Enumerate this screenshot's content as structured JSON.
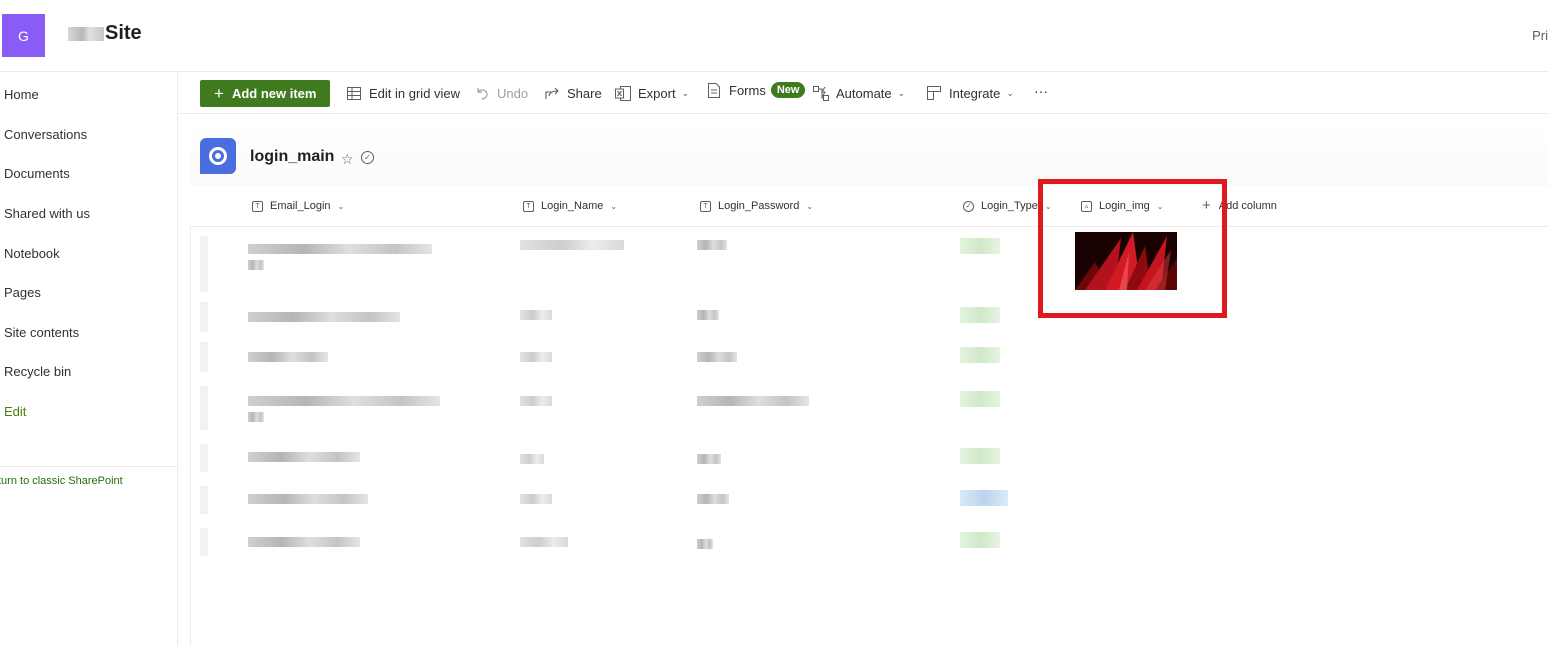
{
  "site": {
    "logo_letter": "G",
    "title": "Site",
    "header_right": "Pri"
  },
  "nav": {
    "items": [
      "Home",
      "Conversations",
      "Documents",
      "Shared with us",
      "Notebook",
      "Pages",
      "Site contents",
      "Recycle bin"
    ],
    "edit": "Edit",
    "classic": "turn to classic SharePoint"
  },
  "commands": {
    "add_new_item": "Add new item",
    "edit_grid": "Edit in grid view",
    "undo": "Undo",
    "share": "Share",
    "export": "Export",
    "forms": "Forms",
    "forms_badge": "New",
    "automate": "Automate",
    "integrate": "Integrate",
    "more": "···"
  },
  "list": {
    "title": "login_main",
    "columns": [
      "Email_Login",
      "Login_Name",
      "Login_Password",
      "Login_Type",
      "Login_img"
    ],
    "add_column": "Add column"
  },
  "colors": {
    "accent_green": "#3f7a1f",
    "logo_purple": "#8a5cf6",
    "list_blue": "#4a6ee0",
    "highlight_red": "#e0191f"
  },
  "icons": {
    "undo": "undo-icon",
    "share": "share-icon",
    "export": "excel-icon",
    "forms": "forms-icon",
    "automate": "automate-icon",
    "integrate": "integrate-icon",
    "grid": "grid-icon"
  }
}
